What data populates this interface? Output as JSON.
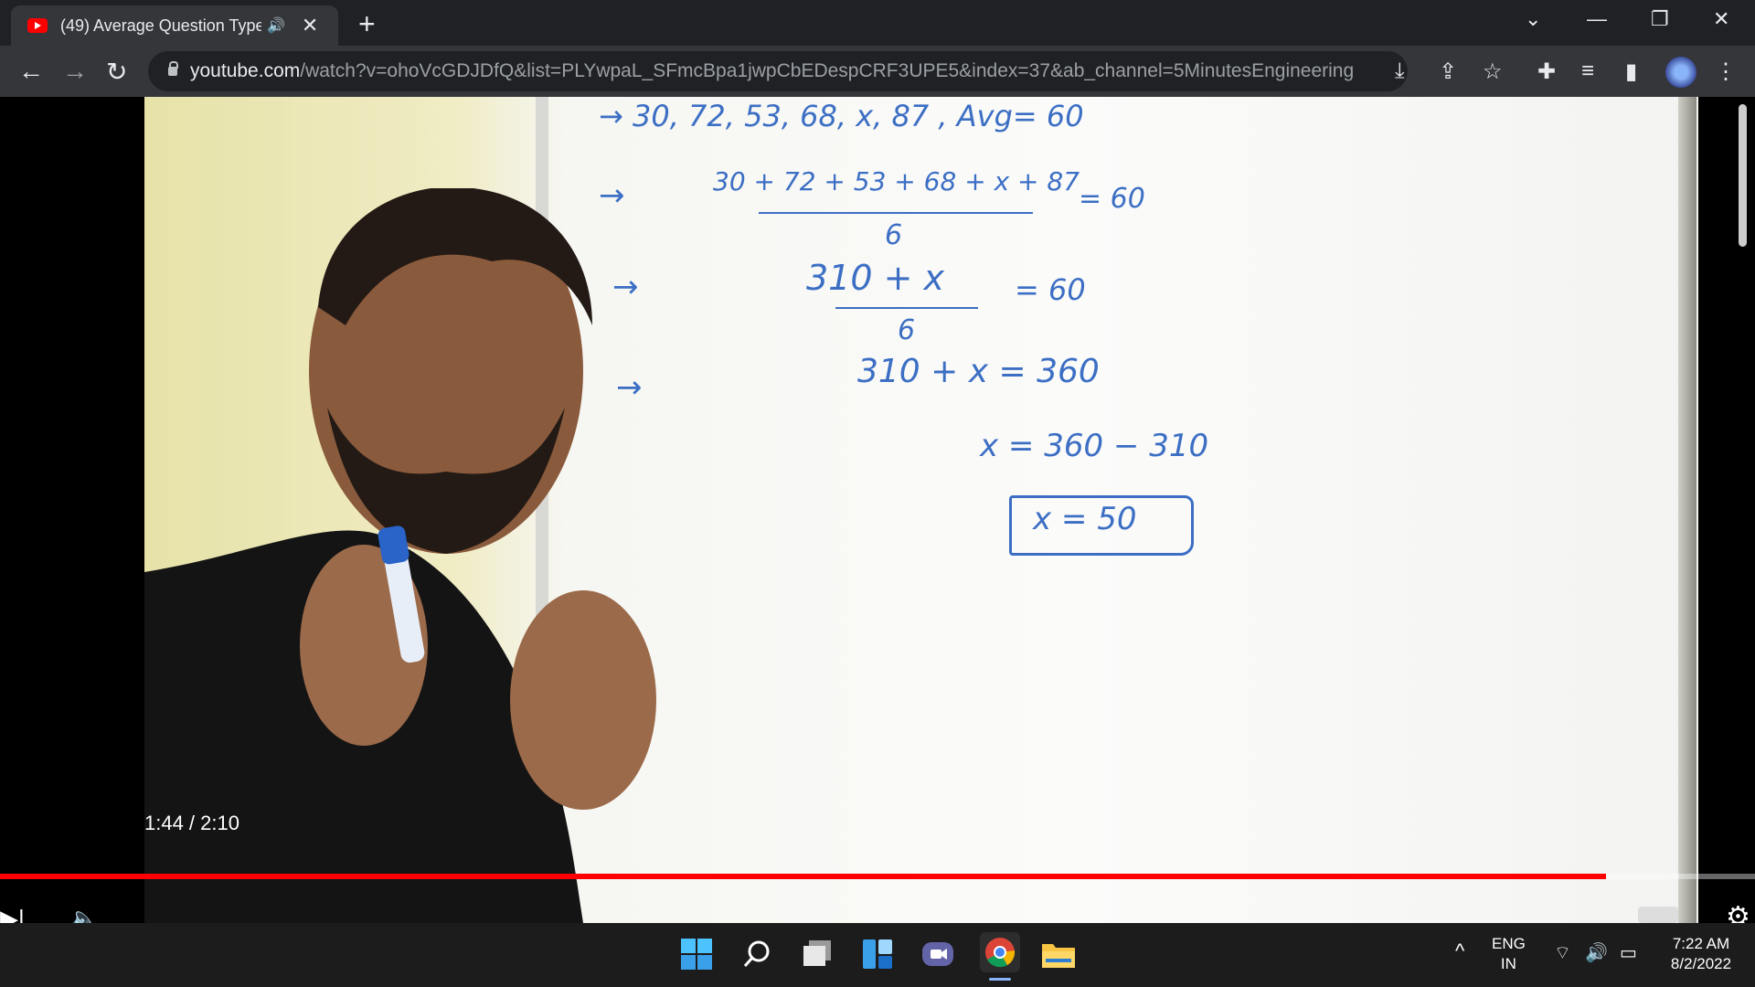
{
  "browser": {
    "tab": {
      "title": "(49) Average Question Type",
      "audio_icon": "speaker-icon"
    },
    "url_host": "youtube.com",
    "url_path": "/watch?v=ohoVcGDJDfQ&list=PLYwpaL_SFmcBpa1jwpCbEDespCRF3UPE5&index=37&ab_channel=5MinutesEngineering"
  },
  "whiteboard": {
    "line1": "→   30, 72, 53, 68, x, 87 , Avg= 60",
    "line2_num": "30 + 72 + 53 + 68 + x + 87",
    "line2_den": "6",
    "line2_rhs": "= 60",
    "line3_num": "310 + x",
    "line3_den": "6",
    "line3_rhs": "= 60",
    "line4": "310 + x = 360",
    "line5": "x = 360 − 310",
    "answer": "x = 50",
    "arrow": "→"
  },
  "player": {
    "time": "1:44 / 2:10",
    "progress": 0.915
  },
  "taskbar": {
    "lang1": "ENG",
    "lang2": "IN",
    "time": "7:22 AM",
    "date": "8/2/2022"
  }
}
